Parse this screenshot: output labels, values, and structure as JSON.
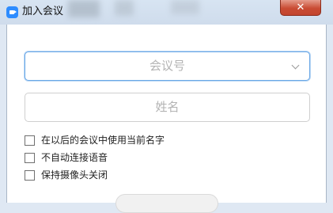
{
  "window": {
    "title": "加入会议",
    "close_symbol": "✕"
  },
  "form": {
    "meeting_id_placeholder": "会议号",
    "name_placeholder": "姓名"
  },
  "options": [
    {
      "label": "在以后的会议中使用当前名字",
      "checked": false
    },
    {
      "label": "不自动连接语音",
      "checked": false
    },
    {
      "label": "保持摄像头关闭",
      "checked": false
    }
  ],
  "icons": {
    "app": "zoom-app-icon",
    "close": "close-icon",
    "dropdown": "chevron-down-icon"
  },
  "colors": {
    "accent": "#2d8cff",
    "close": "#c94c34",
    "focus_border": "#6aa8e6"
  }
}
